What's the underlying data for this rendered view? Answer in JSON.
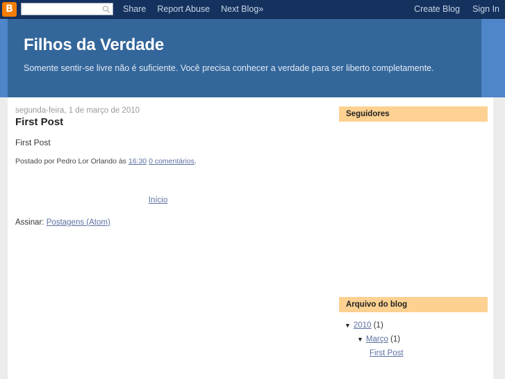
{
  "navbar": {
    "logo_icon": "blogger-b-icon",
    "logo_glyph": "B",
    "search": {
      "value": "",
      "placeholder": "",
      "icon": "search-icon"
    },
    "links": [
      {
        "label": "Share"
      },
      {
        "label": "Report Abuse"
      },
      {
        "label": "Next Blog»"
      }
    ],
    "right_links": [
      {
        "label": "Create Blog"
      },
      {
        "label": "Sign In"
      }
    ]
  },
  "header": {
    "title": "Filhos da Verdade",
    "description": "Somente sentir-se livre não é suficiente. Você precisa conhecer a verdade para ser liberto completamente.",
    "band_color": "#33669a",
    "band_border_color": "#4f85c9"
  },
  "main": {
    "post": {
      "date": "segunda-feira, 1 de março de 2010",
      "title": "First Post",
      "body": "First Post",
      "footer_prefix": "Postado por Pedro Lor Orlando às",
      "footer_time": "16:30",
      "footer_comments": "0 comentários",
      "footer_suffix": "."
    },
    "home_link": "Início",
    "subscribe_label": "Assinar:",
    "subscribe_link": "Postagens (Atom)"
  },
  "sidebar": {
    "followers": {
      "title": "Seguidores",
      "items": []
    },
    "archive": {
      "title": "Arquivo do blog",
      "accent_color": "#fdd191",
      "entries": [
        {
          "level": 1,
          "arrow": "▼",
          "label": "2010",
          "count": "(1)",
          "link": true
        },
        {
          "level": 2,
          "arrow": "▼",
          "label": "Março",
          "count": "(1)",
          "link": true
        },
        {
          "level": 3,
          "arrow": "",
          "label": "First Post",
          "count": "",
          "link": true
        }
      ]
    }
  }
}
